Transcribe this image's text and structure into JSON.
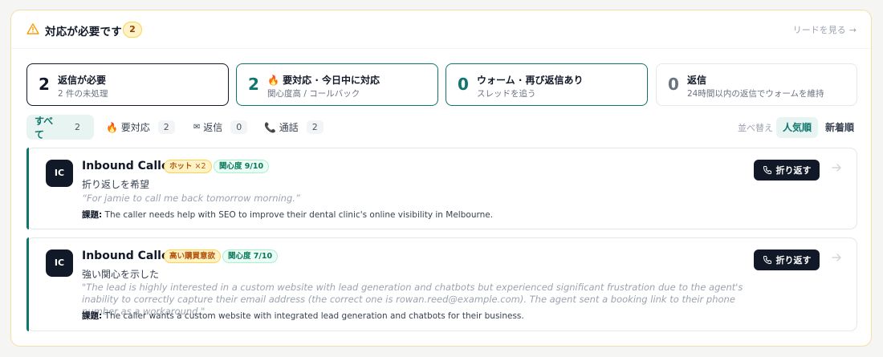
{
  "header": {
    "title": "対応が必要です",
    "count": "2",
    "link": "リードを見る",
    "link_arrow": "→"
  },
  "stats": [
    {
      "num": "2",
      "title": "返信が必要",
      "sub": "2 件の未処理"
    },
    {
      "num": "2",
      "icon": "🔥",
      "title": "要対応 · 今日中に対応",
      "sub": "関心度高 / コールバック"
    },
    {
      "num": "0",
      "title": "ウォーム · 再び返信あり",
      "sub": "スレッドを追う"
    },
    {
      "num": "0",
      "title": "返信",
      "sub": "24時間以内の返信でウォームを維持"
    }
  ],
  "tabs": [
    {
      "label": "すべて",
      "count": "2"
    },
    {
      "icon": "🔥",
      "label": "要対応",
      "count": "2"
    },
    {
      "icon": "✉",
      "label": "返信",
      "count": "0"
    },
    {
      "icon": "📞",
      "label": "通話",
      "count": "2"
    }
  ],
  "sort": {
    "label": "並べ替え",
    "popular": "人気順",
    "newest": "新着順"
  },
  "leads": [
    {
      "initials": "IC",
      "name": "Inbound Caller",
      "tag1": "ホット",
      "tag1_mult": "×2",
      "score": "関心度 9/10",
      "summary": "折り返しを希望",
      "quote": "“For jamie to call me back tomorrow morning.”",
      "issue_label": "課題:",
      "issue": " The caller needs help with SEO to improve their dental clinic's online visibility in Melbourne.",
      "action": "折り返す"
    },
    {
      "initials": "IC",
      "name": "Inbound Caller",
      "tag1": "高い購買意欲",
      "score": "関心度 7/10",
      "summary": "強い関心を示した",
      "quote": "\"The lead is highly interested in a custom website with lead generation and chatbots but experienced significant frustration due to the agent's inability to correctly capture their email address (the correct one is rowan.reed@example.com). The agent sent a booking link to their phone number as a workaround.\"",
      "issue_label": "課題:",
      "issue": " The caller wants a custom website with integrated lead generation and chatbots for their business.",
      "action": "折り返す"
    }
  ],
  "colors": {
    "accent": "#0f766e",
    "dark": "#111827",
    "warning": "#f59e0b"
  }
}
